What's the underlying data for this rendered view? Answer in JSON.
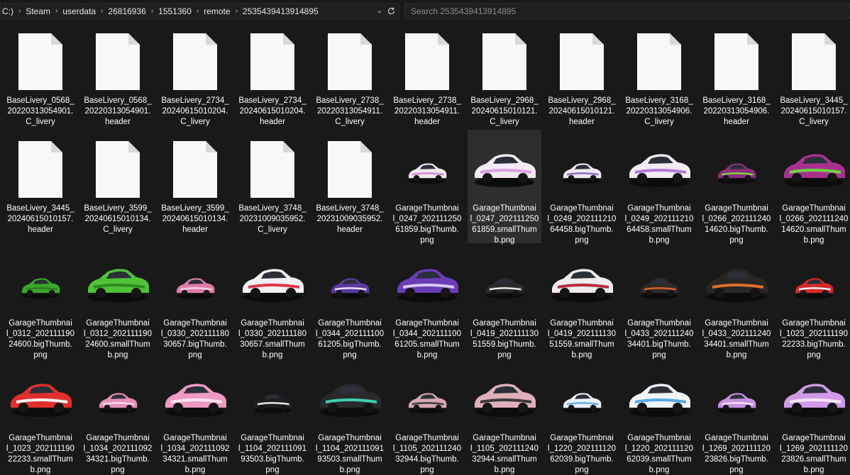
{
  "address": {
    "crumbs": [
      "C:)",
      "Steam",
      "userdata",
      "26816936",
      "1551360",
      "remote",
      "2535439413914895"
    ]
  },
  "search": {
    "placeholder": "Search 2535439413914895"
  },
  "files": [
    {
      "l1": "BaseLivery_0568_",
      "l2": "20220313054901.",
      "l3": "C_livery",
      "type": "doc"
    },
    {
      "l1": "BaseLivery_0568_",
      "l2": "20220313054901.",
      "l3": "header",
      "type": "doc"
    },
    {
      "l1": "BaseLivery_2734_",
      "l2": "20240615010204.",
      "l3": "C_livery",
      "type": "doc"
    },
    {
      "l1": "BaseLivery_2734_",
      "l2": "20240615010204.",
      "l3": "header",
      "type": "doc"
    },
    {
      "l1": "BaseLivery_2738_",
      "l2": "20220313054911.",
      "l3": "C_livery",
      "type": "doc"
    },
    {
      "l1": "BaseLivery_2738_",
      "l2": "20220313054911.",
      "l3": "header",
      "type": "doc"
    },
    {
      "l1": "BaseLivery_2968_",
      "l2": "20240615010121.",
      "l3": "C_livery",
      "type": "doc"
    },
    {
      "l1": "BaseLivery_2968_",
      "l2": "20240615010121.",
      "l3": "header",
      "type": "doc"
    },
    {
      "l1": "BaseLivery_3168_",
      "l2": "20220313054906.",
      "l3": "C_livery",
      "type": "doc"
    },
    {
      "l1": "BaseLivery_3168_",
      "l2": "20220313054906.",
      "l3": "header",
      "type": "doc"
    },
    {
      "l1": "BaseLivery_3445_",
      "l2": "20240615010157.",
      "l3": "C_livery",
      "type": "doc"
    },
    {
      "l1": "BaseLivery_3445_",
      "l2": "20240615010157.",
      "l3": "header",
      "type": "doc"
    },
    {
      "l1": "BaseLivery_3599_",
      "l2": "20240615010134.",
      "l3": "C_livery",
      "type": "doc"
    },
    {
      "l1": "BaseLivery_3599_",
      "l2": "20240615010134.",
      "l3": "header",
      "type": "doc"
    },
    {
      "l1": "BaseLivery_3748_",
      "l2": "20231009035952.",
      "l3": "C_livery",
      "type": "doc"
    },
    {
      "l1": "BaseLivery_3748_",
      "l2": "20231009035952.",
      "l3": "header",
      "type": "doc"
    },
    {
      "l1": "GarageThumbnai",
      "l2": "l_0247_202111250",
      "l3": "61859.bigThumb.",
      "l4": "png",
      "type": "car",
      "body": "#f2e6ee",
      "accent": "#c98ad6",
      "size": "small"
    },
    {
      "l1": "GarageThumbnai",
      "l2": "l_0247_202111250",
      "l3": "61859.smallThum",
      "l4": "b.png",
      "type": "car",
      "body": "#f4eaf3",
      "accent": "#d9a0e0",
      "size": "big",
      "selected": true
    },
    {
      "l1": "GarageThumbnai",
      "l2": "l_0249_202111210",
      "l3": "64458.bigThumb.",
      "l4": "png",
      "type": "car",
      "body": "#f0e8ee",
      "accent": "#8c6fc4",
      "size": "small"
    },
    {
      "l1": "GarageThumbnai",
      "l2": "l_0249_202111210",
      "l3": "64458.smallThum",
      "l4": "b.png",
      "type": "car",
      "body": "#f3eaf2",
      "accent": "#b07ad4",
      "size": "big"
    },
    {
      "l1": "GarageThumbnai",
      "l2": "l_0266_202111240",
      "l3": "14620.bigThumb.",
      "l4": "png",
      "type": "car",
      "body": "#8c2d7a",
      "accent": "#7bd14a",
      "size": "small"
    },
    {
      "l1": "GarageThumbnai",
      "l2": "l_0266_202111240",
      "l3": "14620.smallThum",
      "l4": "b.png",
      "type": "car",
      "body": "#a8318f",
      "accent": "#6fd640",
      "size": "big"
    },
    {
      "l1": "GarageThumbnai",
      "l2": "l_0312_202111190",
      "l3": "24600.bigThumb.",
      "l4": "png",
      "type": "car",
      "body": "#3aa82a",
      "accent": "#2b7d1f",
      "size": "small"
    },
    {
      "l1": "GarageThumbnai",
      "l2": "l_0312_202111190",
      "l3": "24600.smallThum",
      "l4": "b.png",
      "type": "car",
      "body": "#4fc23a",
      "accent": "#2f8a22",
      "size": "big"
    },
    {
      "l1": "GarageThumbnai",
      "l2": "l_0330_202111180",
      "l3": "30657.bigThumb.",
      "l4": "png",
      "type": "car",
      "body": "#e07aa8",
      "accent": "#f5d2e2",
      "size": "small"
    },
    {
      "l1": "GarageThumbnai",
      "l2": "l_0330_202111180",
      "l3": "30657.smallThum",
      "l4": "b.png",
      "type": "car",
      "body": "#f2f0f2",
      "accent": "#e0334a",
      "size": "big"
    },
    {
      "l1": "GarageThumbnai",
      "l2": "l_0344_202111100",
      "l3": "61205.bigThumb.",
      "l4": "png",
      "type": "car",
      "body": "#5b3aa0",
      "accent": "#e8e0f0",
      "size": "small"
    },
    {
      "l1": "GarageThumbnai",
      "l2": "l_0344_202111100",
      "l3": "61205.smallThum",
      "l4": "b.png",
      "type": "car",
      "body": "#6a3cb8",
      "accent": "#d8c8f0",
      "size": "big"
    },
    {
      "l1": "GarageThumbnai",
      "l2": "l_0419_202111130",
      "l3": "51559.bigThumb.",
      "l4": "png",
      "type": "car",
      "body": "#2b2b2b",
      "accent": "#e6e6e6",
      "size": "small"
    },
    {
      "l1": "GarageThumbnai",
      "l2": "l_0419_202111130",
      "l3": "51559.smallThum",
      "l4": "b.png",
      "type": "car",
      "body": "#f0eaea",
      "accent": "#b52a3a",
      "size": "big"
    },
    {
      "l1": "GarageThumbnai",
      "l2": "l_0433_202111240",
      "l3": "34401.bigThumb.",
      "l4": "png",
      "type": "car",
      "body": "#2e2a28",
      "accent": "#d8632a",
      "size": "small"
    },
    {
      "l1": "GarageThumbnai",
      "l2": "l_0433_202111240",
      "l3": "34401.smallThum",
      "l4": "b.png",
      "type": "car",
      "body": "#2a2624",
      "accent": "#e0702e",
      "size": "big"
    },
    {
      "l1": "GarageThumbnai",
      "l2": "l_1023_202111190",
      "l3": "22233.bigThumb.",
      "l4": "png",
      "type": "car",
      "body": "#d42a2a",
      "accent": "#f0f0f0",
      "size": "small"
    },
    {
      "l1": "GarageThumbnai",
      "l2": "l_1023_202111190",
      "l3": "22233.smallThum",
      "l4": "b.png",
      "type": "car",
      "body": "#e0302e",
      "accent": "#f2f2f2",
      "size": "big"
    },
    {
      "l1": "GarageThumbnai",
      "l2": "l_1034_202111092",
      "l3": "34321.bigThumb.",
      "l4": "png",
      "type": "car",
      "body": "#e58fb8",
      "accent": "#f7dbe8",
      "size": "small"
    },
    {
      "l1": "GarageThumbnai",
      "l2": "l_1034_202111092",
      "l3": "34321.smallThum",
      "l4": "b.png",
      "type": "car",
      "body": "#ee9ac2",
      "accent": "#fbe4ef",
      "size": "big"
    },
    {
      "l1": "GarageThumbnai",
      "l2": "l_1104_202111091",
      "l3": "93503.bigThumb.",
      "l4": "png",
      "type": "car",
      "body": "#1e1e1e",
      "accent": "#e8e8e8",
      "size": "small"
    },
    {
      "l1": "GarageThumbnai",
      "l2": "l_1104_202111091",
      "l3": "93503.smallThum",
      "l4": "b.png",
      "type": "car",
      "body": "#2a2a2a",
      "accent": "#3fd0b0",
      "size": "big"
    },
    {
      "l1": "GarageThumbnai",
      "l2": "l_1105_202111240",
      "l3": "32944.bigThumb.",
      "l4": "png",
      "type": "car",
      "body": "#d8a8b0",
      "accent": "#3a3a3a",
      "size": "small"
    },
    {
      "l1": "GarageThumbnai",
      "l2": "l_1105_202111240",
      "l3": "32944.smallThum",
      "l4": "b.png",
      "type": "car",
      "body": "#e0b0b8",
      "accent": "#3a3a3a",
      "size": "big"
    },
    {
      "l1": "GarageThumbnai",
      "l2": "l_1220_202111120",
      "l3": "62039.bigThumb.",
      "l4": "png",
      "type": "car",
      "body": "#e8f0f8",
      "accent": "#6ab0e0",
      "size": "small"
    },
    {
      "l1": "GarageThumbnai",
      "l2": "l_1220_202111120",
      "l3": "62039.smallThum",
      "l4": "b.png",
      "type": "car",
      "body": "#eef4fa",
      "accent": "#5aa8e0",
      "size": "big"
    },
    {
      "l1": "GarageThumbnai",
      "l2": "l_1269_202111120",
      "l3": "23826.bigThumb.",
      "l4": "png",
      "type": "car",
      "body": "#c890e0",
      "accent": "#f0e0f4",
      "size": "small"
    },
    {
      "l1": "GarageThumbnai",
      "l2": "l_1269_202111120",
      "l3": "23826.smallThum",
      "l4": "b.png",
      "type": "car",
      "body": "#d09ae6",
      "accent": "#f4e6f8",
      "size": "big"
    }
  ]
}
